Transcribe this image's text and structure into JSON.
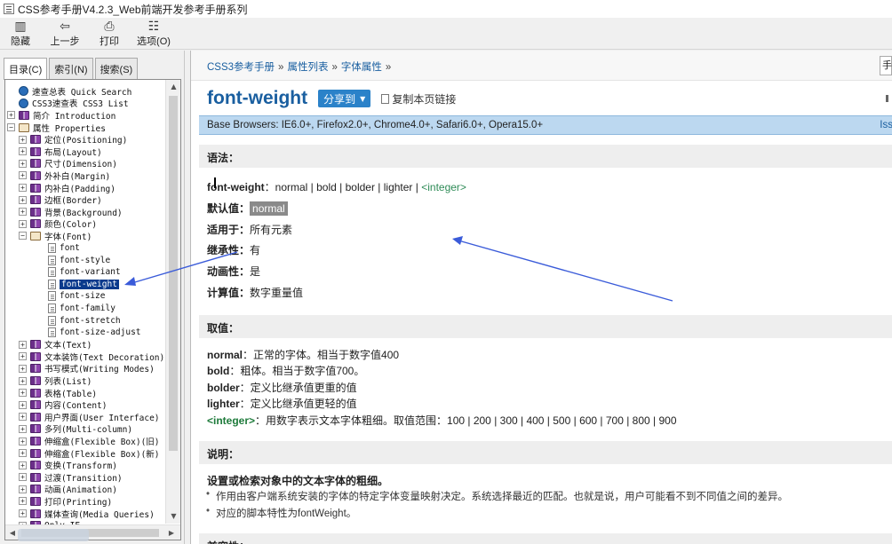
{
  "window": {
    "title": "CSS参考手册V4.2.3_Web前端开发参考手册系列"
  },
  "toolbar": {
    "hide_label": "隐藏",
    "back_label": "上一步",
    "print_label": "打印",
    "options_label": "选项(O)"
  },
  "left_tabs": {
    "contents": "目录(C)",
    "index": "索引(N)",
    "search": "搜索(S)"
  },
  "tree": {
    "quick_search": "速查总表 Quick Search",
    "css3_list": "CSS3速查表 CSS3 List",
    "intro": "简介 Introduction",
    "properties": "属性 Properties",
    "positioning": "定位(Positioning)",
    "layout": "布局(Layout)",
    "dimension": "尺寸(Dimension)",
    "margin": "外补白(Margin)",
    "padding": "内补白(Padding)",
    "border": "边框(Border)",
    "background": "背景(Background)",
    "color": "颜色(Color)",
    "font_group": "字体(Font)",
    "font": "font",
    "font_style": "font-style",
    "font_variant": "font-variant",
    "font_weight": "font-weight",
    "font_size": "font-size",
    "font_family": "font-family",
    "font_stretch": "font-stretch",
    "font_size_adjust": "font-size-adjust",
    "text": "文本(Text)",
    "text_decoration": "文本装饰(Text Decoration)",
    "writing_modes": "书写模式(Writing Modes)",
    "list": "列表(List)",
    "table": "表格(Table)",
    "content": "内容(Content)",
    "user_interface": "用户界面(User Interface)",
    "multi_column": "多列(Multi-column)",
    "flexbox_old": "伸缩盒(Flexible Box)(旧)",
    "flexbox_new": "伸缩盒(Flexible Box)(新)",
    "transform": "变换(Transform)",
    "transition": "过渡(Transition)",
    "animation": "动画(Animation)",
    "printing": "打印(Printing)",
    "media_queries": "媒体查询(Media Queries)",
    "only_ie": "Only IE"
  },
  "breadcrumb": {
    "item1": "CSS3参考手册",
    "item2": "属性列表",
    "item3": "字体属性",
    "sep": "»"
  },
  "page": {
    "title": "font-weight",
    "share_label": "分享到",
    "copy_link_label": "复制本页链接",
    "browsers": "Base Browsers: IE6.0+, Firefox2.0+, Chrome4.0+, Safari6.0+, Opera15.0+",
    "browsers_right": "Iss"
  },
  "syntax": {
    "heading": "语法：",
    "syntax_prop": "font-weight",
    "syntax_values": "：normal | bold | bolder | lighter |",
    "syntax_integer": "<integer>",
    "default_label": "默认值：",
    "default_value": "normal",
    "applies_label": "适用于：",
    "applies_value": "所有元素",
    "inherited_label": "继承性：",
    "inherited_value": "有",
    "animatable_label": "动画性：",
    "animatable_value": "是",
    "computed_label": "计算值：",
    "computed_value": "数字重量值"
  },
  "values": {
    "heading": "取值：",
    "normal_kw": "normal",
    "normal_desc": "：正常的字体。相当于数字值400",
    "bold_kw": "bold",
    "bold_desc": "：粗体。相当于数字值700。",
    "bolder_kw": "bolder",
    "bolder_desc": "：定义比继承值更重的值",
    "lighter_kw": "lighter",
    "lighter_desc": "：定义比继承值更轻的值",
    "integer_kw": "<integer>",
    "integer_desc": "：用数字表示文本字体粗细。取值范围：100 | 200 | 300 | 400 | 500 | 600 | 700 | 800 | 900"
  },
  "notes": {
    "heading": "说明：",
    "summary": "设置或检索对象中的文本字体的粗细。",
    "bullet1": "作用由客户端系统安装的字体的特定字体变量映射决定。系统选择最近的匹配。也就是说，用户可能看不到不同值之间的差异。",
    "bullet2": "对应的脚本特性为fontWeight。",
    "next_heading": "兼容性："
  },
  "colors": {
    "link": "#1a5fa0",
    "accent_bar": "#bcd8f0",
    "selection": "#0a3a8c",
    "annotation_arrow": "#3a5bd9"
  },
  "icons": [
    "hide-icon",
    "back-icon",
    "print-icon",
    "options-icon",
    "book-icon",
    "page-icon",
    "expand-icon"
  ]
}
